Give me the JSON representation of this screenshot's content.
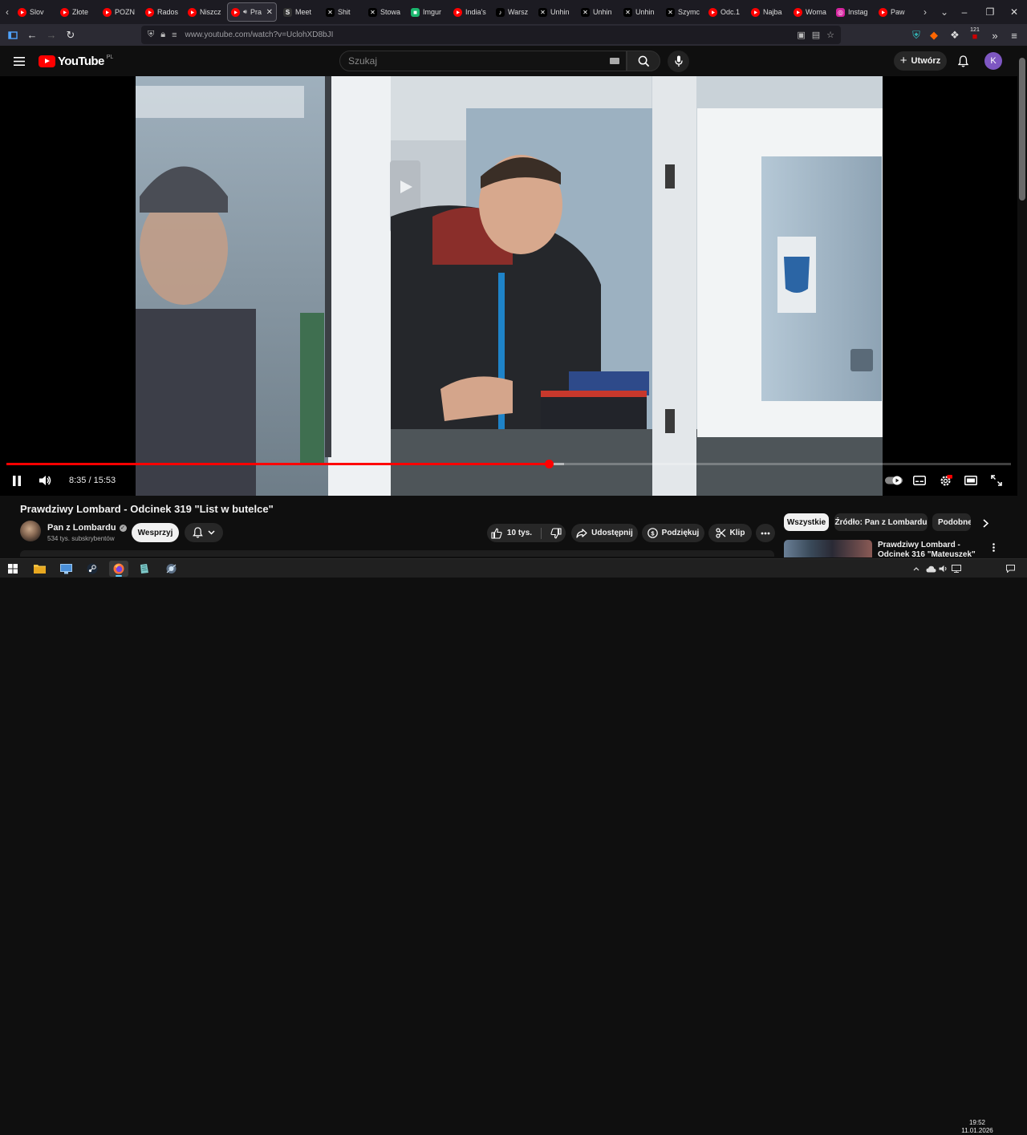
{
  "browser": {
    "tabs": [
      {
        "label": "Slov",
        "fav": "yt",
        "color": "#ff0000"
      },
      {
        "label": "Złote",
        "fav": "yt",
        "color": "#ff0000"
      },
      {
        "label": "POZN",
        "fav": "yt",
        "color": "#ff0000"
      },
      {
        "label": "Rados",
        "fav": "yt",
        "color": "#ff0000"
      },
      {
        "label": "Niszcz",
        "fav": "yt",
        "color": "#ff0000"
      },
      {
        "label": "Pra",
        "fav": "yt",
        "color": "#ff0000",
        "active": true
      },
      {
        "label": "Meet",
        "fav": "S",
        "color": "#333333"
      },
      {
        "label": "Shit",
        "fav": "X",
        "color": "#000000"
      },
      {
        "label": "Stowa",
        "fav": "X",
        "color": "#000000"
      },
      {
        "label": "Imgur",
        "fav": "img",
        "color": "#1bb76e"
      },
      {
        "label": "India's",
        "fav": "yt",
        "color": "#ff0000"
      },
      {
        "label": "Warsz",
        "fav": "tt",
        "color": "#000000"
      },
      {
        "label": "Unhin",
        "fav": "X",
        "color": "#000000"
      },
      {
        "label": "Unhin",
        "fav": "X",
        "color": "#000000"
      },
      {
        "label": "Unhin",
        "fav": "X",
        "color": "#000000"
      },
      {
        "label": "Szymc",
        "fav": "X",
        "color": "#000000"
      },
      {
        "label": "Odc.1",
        "fav": "yt",
        "color": "#ff0000"
      },
      {
        "label": "Najba",
        "fav": "yt",
        "color": "#ff0000"
      },
      {
        "label": "Woma",
        "fav": "yt",
        "color": "#ff0000"
      },
      {
        "label": "Instag",
        "fav": "ig",
        "color": "#d6249f"
      },
      {
        "label": "Paw",
        "fav": "yt",
        "color": "#ff0000"
      }
    ],
    "url_host": "www.youtube.com",
    "url_path": "/watch?v=UclohXD8bJI",
    "ext_badge": "121"
  },
  "youtube": {
    "logo_text": "YouTube",
    "country": "PL",
    "search_placeholder": "Szukaj",
    "create_label": "Utwórz",
    "avatar_letter": "K"
  },
  "player": {
    "time_current": "8:35",
    "time_total": "15:53",
    "played_fraction": 0.54,
    "buffered_fraction": 0.555
  },
  "video": {
    "title": "Prawdziwy Lombard - Odcinek 319 \"List w butelce\"",
    "channel": "Pan z Lombardu",
    "subscribers": "534 tys. subskrybentów",
    "join_label": "Wesprzyj",
    "likes": "10 tys.",
    "share_label": "Udostępnij",
    "thanks_label": "Podziękuj",
    "clip_label": "Klip"
  },
  "chips": [
    {
      "label": "Wszystkie",
      "active": true
    },
    {
      "label": "Źródło: Pan z Lombardu",
      "active": false
    },
    {
      "label": "Podobne",
      "active": false
    }
  ],
  "recommendation": {
    "title": "Prawdziwy Lombard - Odcinek 316 \"Mateuszek\""
  },
  "taskbar": {
    "time": "19:52",
    "date": "11.01.2026"
  },
  "colors": {
    "accent_red": "#ff0000",
    "page_bg": "#0f0f0f",
    "pill_bg": "#272727"
  }
}
